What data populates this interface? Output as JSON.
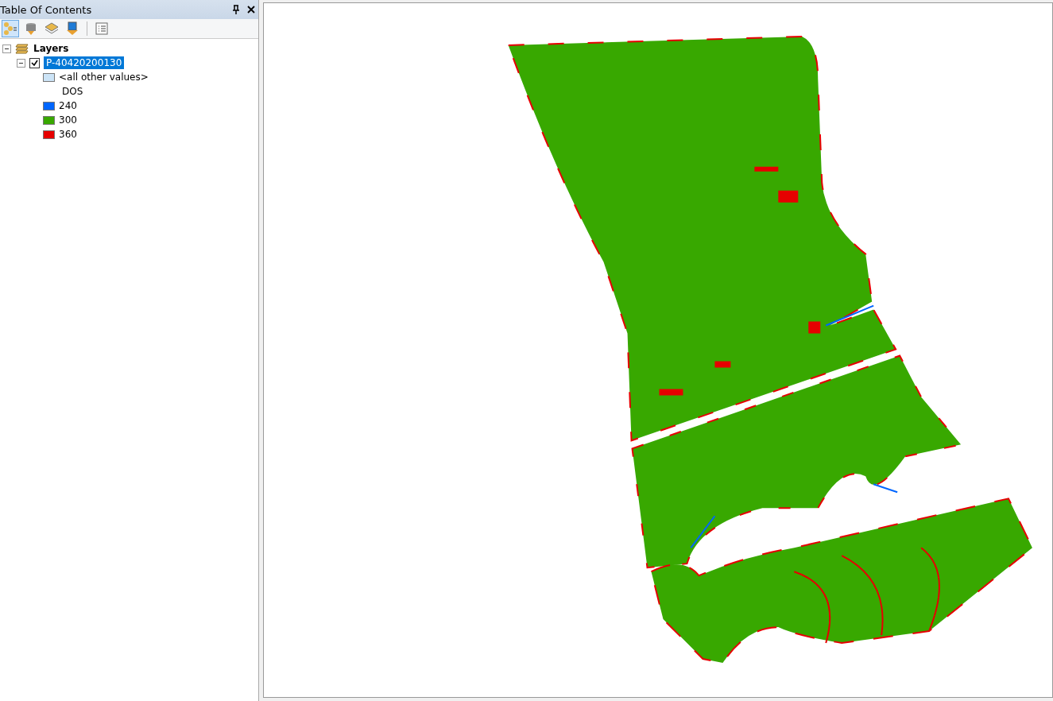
{
  "panel": {
    "title": "Table Of Contents"
  },
  "toolbar": [
    {
      "kind": "drawing-order",
      "selected": true
    },
    {
      "kind": "source",
      "selected": false
    },
    {
      "kind": "visibility",
      "selected": false
    },
    {
      "kind": "selection",
      "selected": false
    },
    {
      "kind": "options",
      "selected": false
    }
  ],
  "tree": {
    "label": "Layers",
    "expanded": true,
    "children": [
      {
        "label": "P-40420200130",
        "checked": true,
        "selected": true,
        "expanded": true,
        "legend": [
          {
            "kind": "swatch",
            "label": "<all other values>",
            "color": "#cce4f7"
          },
          {
            "kind": "heading",
            "label": "DOS"
          },
          {
            "kind": "swatch",
            "label": "240",
            "color": "#0066ff"
          },
          {
            "kind": "swatch",
            "label": "300",
            "color": "#38a800"
          },
          {
            "kind": "swatch",
            "label": "360",
            "color": "#e60000"
          }
        ]
      }
    ]
  }
}
